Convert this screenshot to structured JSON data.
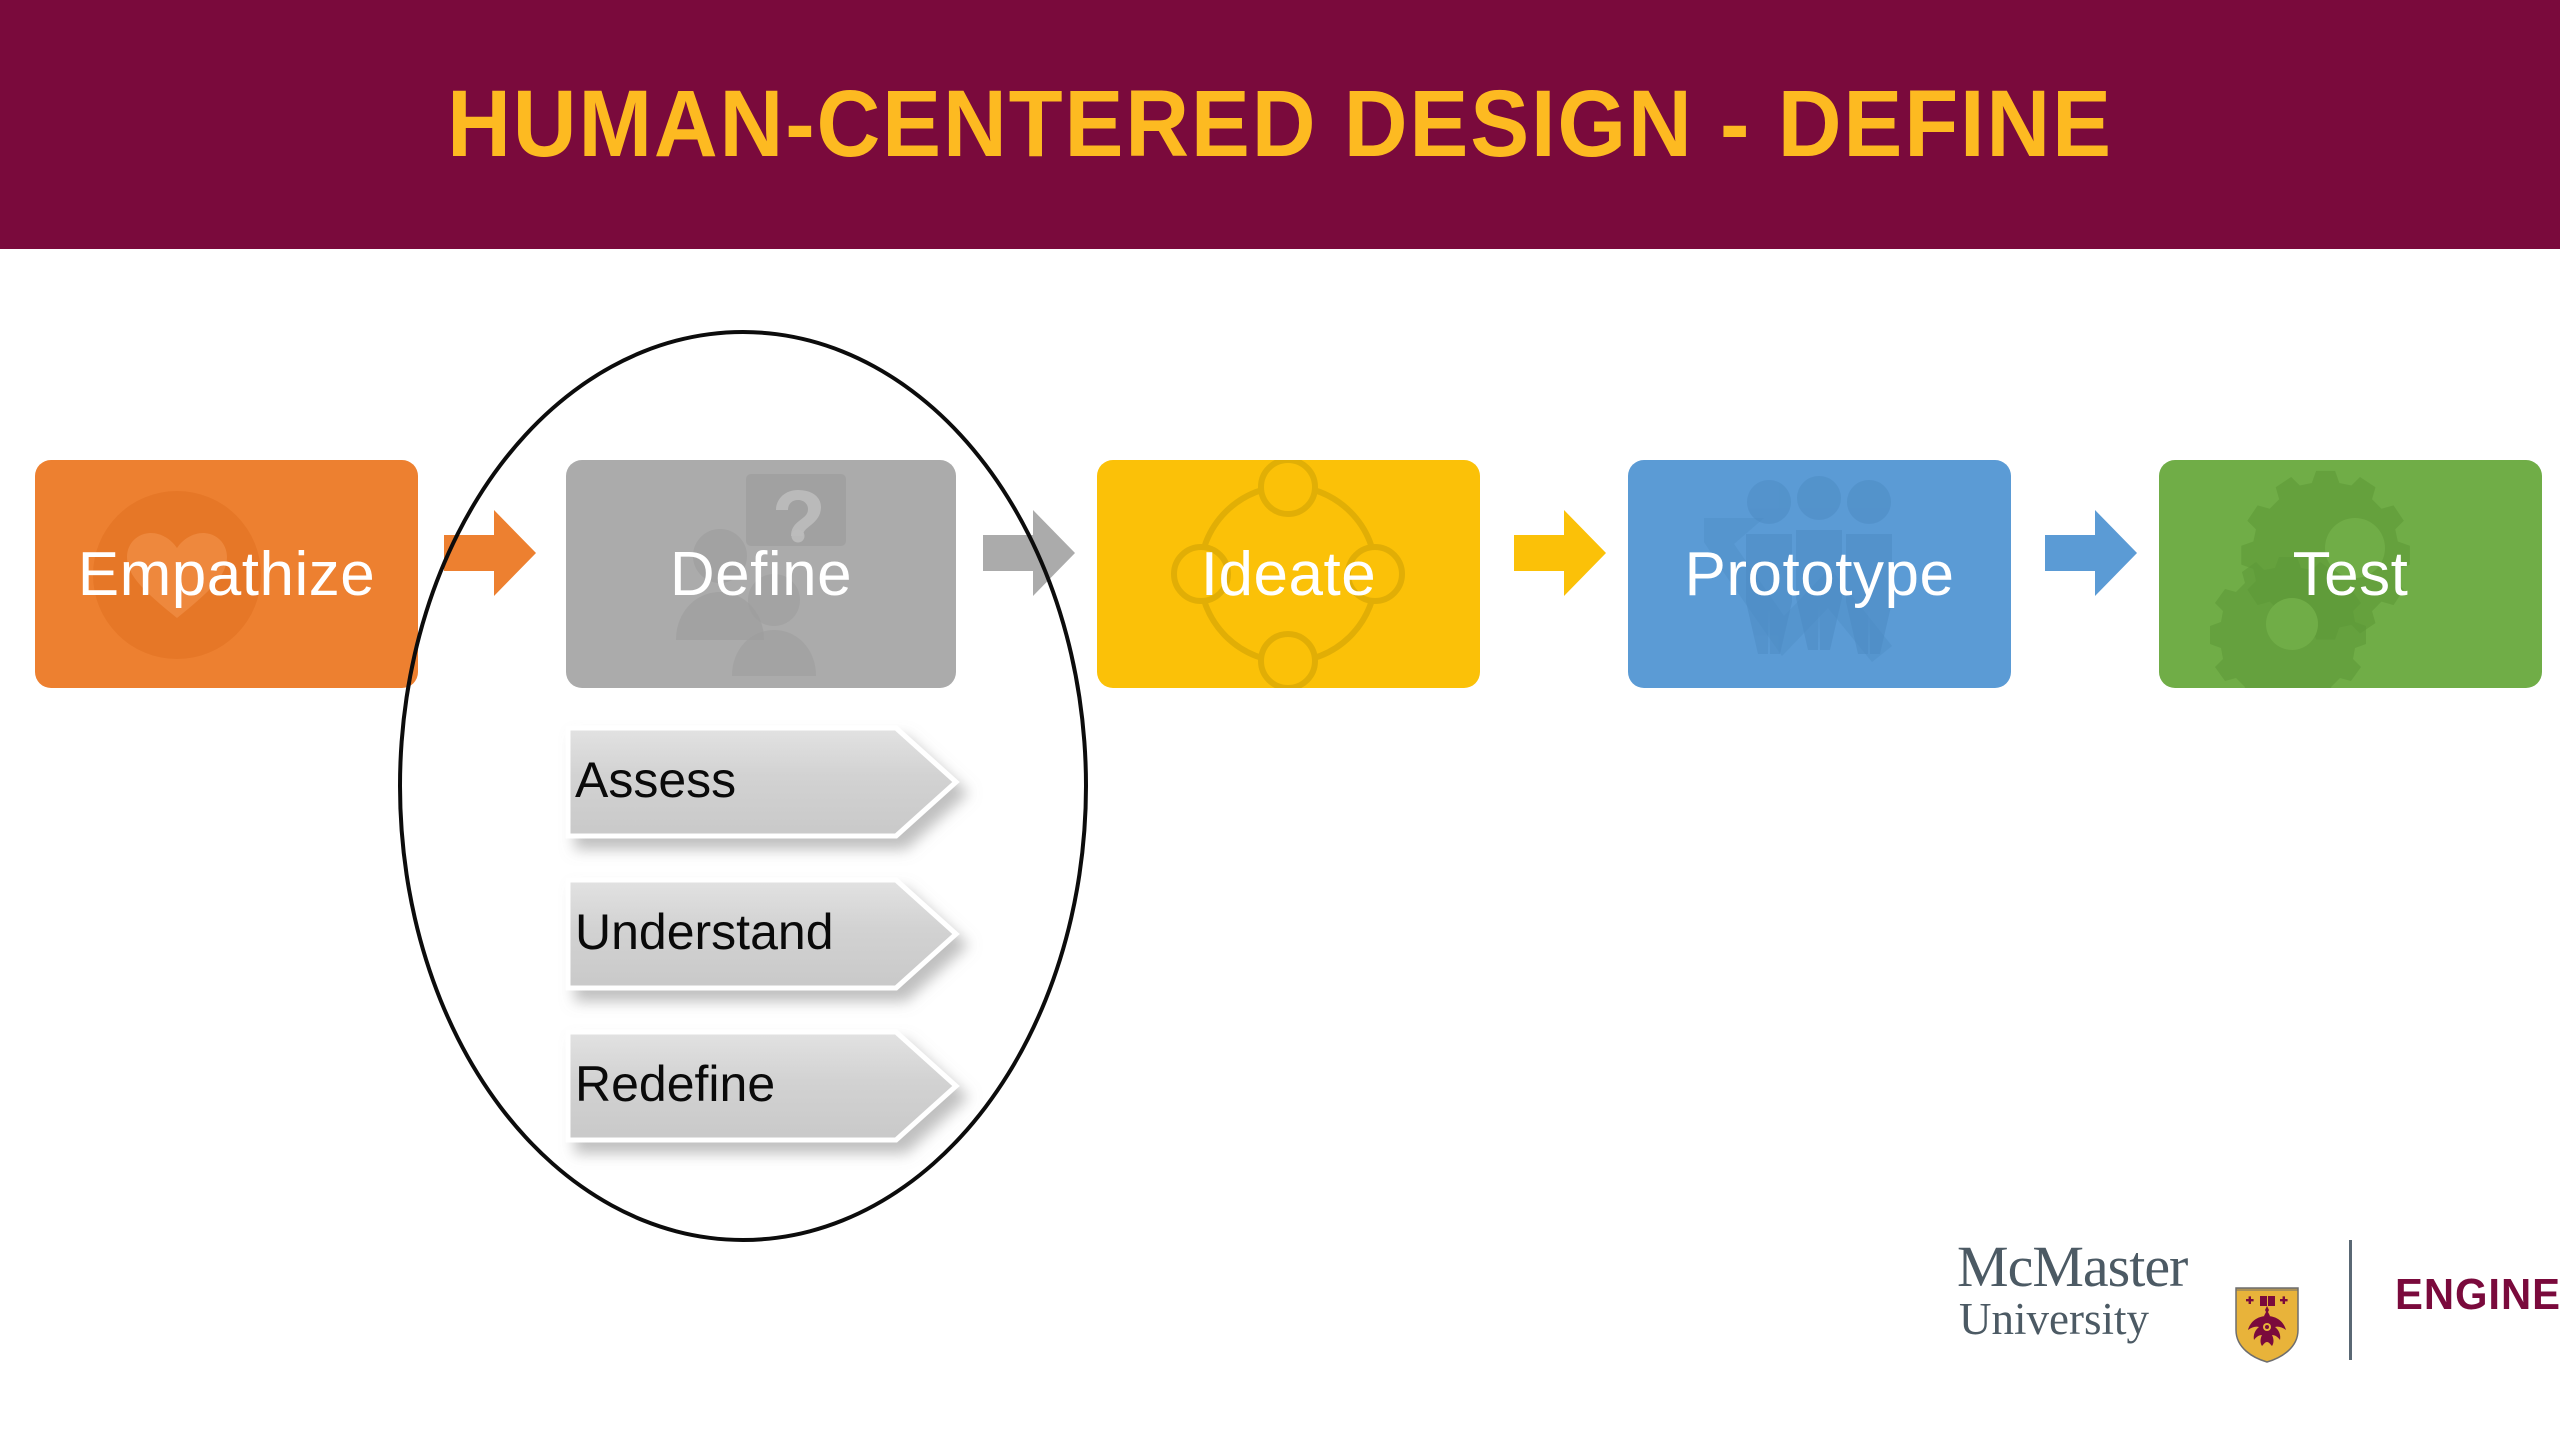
{
  "slide": {
    "title": "HUMAN-CENTERED DESIGN - DEFINE",
    "title_color": "#FDBA21",
    "header_color": "#7A0A3C",
    "background_color": "#FFFFFF"
  },
  "process": {
    "stages": [
      {
        "label": "Empathize",
        "color": "#ED8030",
        "icon": "heart-in-circle-icon",
        "highlighted": false
      },
      {
        "label": "Define",
        "color": "#ABABAB",
        "icon": "people-question-mark-icon",
        "highlighted": true
      },
      {
        "label": "Ideate",
        "color": "#FBC108",
        "icon": "connected-nodes-icon",
        "highlighted": false
      },
      {
        "label": "Prototype",
        "color": "#5B9BD5",
        "icon": "three-people-chart-icon",
        "highlighted": false
      },
      {
        "label": "Test",
        "color": "#70AD47",
        "icon": "gears-icon",
        "highlighted": false
      }
    ],
    "arrows": [
      {
        "name": "arrow-empathize-to-define",
        "color": "#ED8030"
      },
      {
        "name": "arrow-define-to-ideate",
        "color": "#ABABAB"
      },
      {
        "name": "arrow-ideate-to-prototype",
        "color": "#FBC108"
      },
      {
        "name": "arrow-prototype-to-test",
        "color": "#5B9BD5"
      }
    ]
  },
  "define_detail": {
    "highlight_shape": "ellipse",
    "highlight_stroke": "#0C0C0C",
    "substeps": [
      {
        "label": "Assess"
      },
      {
        "label": "Understand"
      },
      {
        "label": "Redefine"
      }
    ]
  },
  "logo": {
    "mcmaster": "McMaster",
    "university": "University",
    "faculty": "ENGINEERING",
    "wordmark_color": "#4C5A64",
    "faculty_color": "#7A0A3C",
    "crest_gold": "#E8B33A",
    "crest_maroon": "#7A0A3C"
  }
}
